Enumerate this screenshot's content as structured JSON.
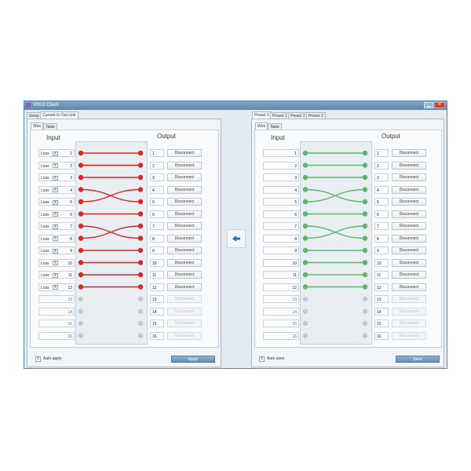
{
  "window": {
    "title": "VM16 Client",
    "close_glyph": "×"
  },
  "main_tabs": [
    "Setup",
    "Current In-Out Link"
  ],
  "preset_tabs": [
    "Preset 0",
    "Preset 1",
    "Preset 2",
    "Preset 3"
  ],
  "view_tabs": [
    "Wire",
    "Table"
  ],
  "input_header": "Input",
  "output_header": "Output",
  "loss_label": "Loss",
  "check_glyph": "x",
  "disconnect_label": "Disconnect",
  "row_numbers": [
    "1",
    "2",
    "3",
    "4",
    "5",
    "6",
    "7",
    "8",
    "9",
    "10",
    "11",
    "12",
    "13",
    "14",
    "15",
    "16"
  ],
  "left_panel": {
    "connections": [
      [
        1,
        1
      ],
      [
        2,
        2
      ],
      [
        3,
        3
      ],
      [
        4,
        5
      ],
      [
        5,
        4
      ],
      [
        6,
        6
      ],
      [
        7,
        8
      ],
      [
        8,
        7
      ],
      [
        9,
        9
      ],
      [
        10,
        10
      ],
      [
        11,
        11
      ],
      [
        12,
        12
      ]
    ],
    "wire_color": "#d42a2a",
    "checkbox_label": "Auto apply",
    "checkbox_checked": true,
    "action_label": "Apply"
  },
  "right_panel": {
    "connections": [
      [
        1,
        1
      ],
      [
        2,
        2
      ],
      [
        3,
        3
      ],
      [
        4,
        5
      ],
      [
        5,
        4
      ],
      [
        6,
        6
      ],
      [
        7,
        8
      ],
      [
        8,
        7
      ],
      [
        9,
        9
      ],
      [
        10,
        10
      ],
      [
        11,
        11
      ],
      [
        12,
        12
      ]
    ],
    "wire_color": "#5fb56a",
    "checkbox_label": "Auto save",
    "checkbox_checked": true,
    "action_label": "Save"
  },
  "colors": {
    "inactive_dot": "#c2c9d0",
    "arrow": "#2f6fb6"
  },
  "icons": {
    "transfer": "arrow-left-icon",
    "app": "app-icon",
    "minimize": "minimize-icon",
    "close": "close-icon"
  }
}
